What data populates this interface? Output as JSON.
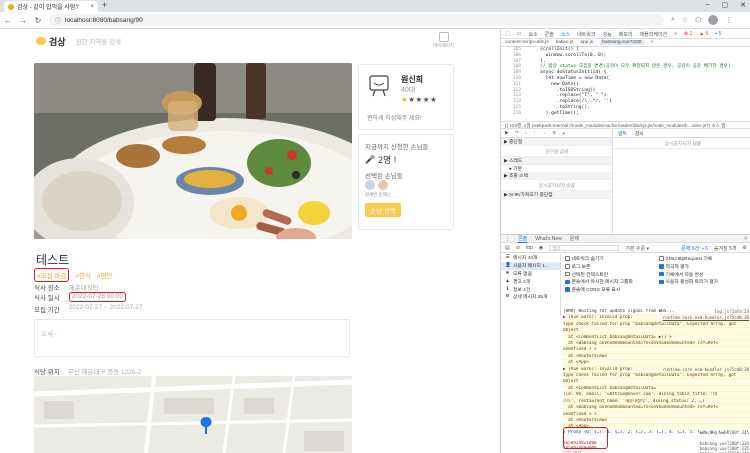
{
  "browser": {
    "tab_title": "검상 - 같이 밥먹을 사람?",
    "tab_close": "×",
    "new_tab": "+",
    "window_controls": [
      "–",
      "▢",
      "✕"
    ],
    "url": "localhost:8080/babsang/90",
    "profile_letter": ""
  },
  "site": {
    "logo_text": "검상",
    "search_placeholder": "원한 지역을 검색",
    "mypage_label": "마이페이지"
  },
  "host": {
    "name": "원신희",
    "age": "40대",
    "rating": 1,
    "stars": [
      "★",
      "★",
      "★",
      "★",
      "★"
    ],
    "message": "편하게 작성해주 세요!"
  },
  "applicants": {
    "label": "지금까지 신청한 손님들",
    "count_icon": "🎤",
    "count": "2명 !",
    "selected_label": "선택된 손님들",
    "selected_names": "원세빈 민재는",
    "select_button": "손님 선택"
  },
  "post": {
    "title": "테스트",
    "tags": [
      "#모집 마감",
      "#한식",
      "#편안"
    ],
    "info": [
      {
        "key": "식사 장소",
        "value": "해운대정탁"
      },
      {
        "key": "식사 일시",
        "value": "2022-07-28 00:00"
      },
      {
        "key": "모집 기간",
        "value": "2022-07-27 ~ 2022-07-27"
      }
    ],
    "content": "오세~",
    "location_key": "식당 위치",
    "location_value": "부산 해운대구 중동 1226-2"
  },
  "devtools": {
    "toolbar": [
      "요소",
      "콘솔",
      "소스",
      "네트워크",
      "성능",
      "메모리",
      "애플리케이션",
      "»"
    ],
    "toolbar_active": "소스",
    "badges": {
      "errors": "⊗ 1",
      "warnings": "▲ 6",
      "info": "▪ 5"
    },
    "file_tabs": [
      "content-script-utils.js",
      "kakao.js",
      "app.js",
      "babsang.vue?280f",
      "×"
    ],
    "active_file": "babsang.vue?280f",
    "code_lines": [
      {
        "n": "105",
        "t": "    scrollInit() {"
      },
      {
        "n": "106",
        "t": "      window.scrollTo(0, 0);"
      },
      {
        "n": "107",
        "t": "    },"
      },
      {
        "n": "108",
        "t": "    // 밥상 status 모집중 변경(공감이 모두 확정되지 않은 경우, 공감이 공감 배기한 경우)"
      },
      {
        "n": "109",
        "t": "    async doStatusInit(id) {"
      },
      {
        "n": "110",
        "t": "      let nowTime = new Date("
      },
      {
        "n": "111",
        "t": "        new Date()"
      },
      {
        "n": "112",
        "t": "          .toISOString()"
      },
      {
        "n": "113",
        "t": "          .replace(\"T\", \" \")"
      },
      {
        "n": "114",
        "t": "          .replace(/\\..*/, '')"
      },
      {
        "n": "115",
        "t": "          .toString(),"
      },
      {
        "n": "116",
        "t": "      ).getTime();"
      }
    ],
    "status_line": "{}   124행, 1열  (webpack-internal:///node_modules/cache-loader/dist/cjs.js!/node_modules/b...ndex.js?) 소스 맵",
    "debugger_controls": [
      "▶",
      "↷",
      "↓",
      "↑",
      "→",
      "⊘",
      "⏸"
    ],
    "watch_label": "▶ 중단점",
    "paused_text": "중단점 없음",
    "scope_label": "▶ 스레드",
    "thread_main": "● 기본",
    "callstack_label": "▶ 호출 스택",
    "not_paused": "일시중지되지 않음",
    "xhr_label": "▶ XHR/가져오기 중단점",
    "right_tabs": [
      "범위",
      "감시"
    ],
    "right_empty": "일시중지되지 않음",
    "drawer_tabs": [
      "콘솔",
      "What's New",
      "문제",
      "×"
    ],
    "console_context": "top",
    "filter_placeholder": "필터",
    "level": "기본 수준 ▾",
    "issues": "문제 6건: ▪ 6",
    "hidden": "숨겨짐 5개",
    "side": [
      {
        "icon": "☰",
        "label": "메시지 44개"
      },
      {
        "icon": "👤",
        "label": "사용자 메시지 1..."
      },
      {
        "icon": "⊗",
        "label": "오류 없음"
      },
      {
        "icon": "▲",
        "label": "경고 2개"
      },
      {
        "icon": "ℹ",
        "label": "정보 4건"
      },
      {
        "icon": "⚙",
        "label": "상세 메시지 35개"
      }
    ],
    "side_active": 1,
    "options": [
      {
        "label": "네트워크 숨기기",
        "on": false
      },
      {
        "label": "XMLHttpRequest 기록",
        "on": false
      },
      {
        "label": "로그 보존",
        "on": false
      },
      {
        "label": "적극적 평가",
        "on": true
      },
      {
        "label": "선택된 컨텍스트만",
        "on": false
      },
      {
        "label": "기록에서 자동 완성",
        "on": true
      },
      {
        "label": "콘솔에서 유사한 메시지 그룹화",
        "on": true
      },
      {
        "label": "사용자 활성화 트리거 평가",
        "on": true
      },
      {
        "label": "콘솔에 CORS 오류 표시",
        "on": true
      }
    ],
    "log": [
      {
        "cls": "hmr",
        "text": "[HMR] Waiting for update signal from WDS...",
        "src": "log.js?1afd:24"
      },
      {
        "cls": "warn",
        "text": "▶ [Vue warn]: Invalid prop:",
        "src": "runtime-core.esm-bundler.js?5c40:38"
      },
      {
        "cls": "warn",
        "text": "type check failed for prop \"babsangDetailData\". Expected Array, got",
        "src": ""
      },
      {
        "cls": "warn",
        "text": "Object",
        "src": ""
      },
      {
        "cls": "warn",
        "text": "  at <CommentList babsangDetailData= ▶{} >",
        "src": ""
      },
      {
        "cls": "warn",
        "text": "  at <Babsang onVnodeUnmounted=fn<onVnodeUnmounted> ref=Ref<",
        "src": ""
      },
      {
        "cls": "warn",
        "text": "undefined > >",
        "src": ""
      },
      {
        "cls": "warn",
        "text": "  at <RouterView>",
        "src": ""
      },
      {
        "cls": "warn",
        "text": "  at <App>",
        "src": ""
      },
      {
        "cls": "warn",
        "text": "▶ [Vue warn]: Invalid prop:",
        "src": "runtime-core.esm-bundler.js?5c40:38"
      },
      {
        "cls": "warn",
        "text": "type check failed for prop \"babsangDetailData\". Expected Array, got",
        "src": ""
      },
      {
        "cls": "warn",
        "text": "Object",
        "src": ""
      },
      {
        "cls": "warn",
        "text": "  at <CommentList babsangDetailData=",
        "src": ""
      },
      {
        "cls": "warn",
        "text": "{id: 90, email: 'u0ttrue@naver.com', dining_table_title: '테",
        "src": ""
      },
      {
        "cls": "warn",
        "text": "스트', restaurant_name: '해운대정탁', dining_status: 2, …}",
        "src": ""
      },
      {
        "cls": "warn",
        "text": "  at <Babsang onVnodeUnmounted=fn<onVnodeUnmounted> ref=Ref<",
        "src": ""
      },
      {
        "cls": "warn",
        "text": "undefined > >",
        "src": ""
      },
      {
        "cls": "warn",
        "text": "  at <RouterView>",
        "src": ""
      },
      {
        "cls": "warn",
        "text": "  at <App>",
        "src": ""
      },
      {
        "cls": "blue",
        "text": "▶ Proxy {0: {…}, 1: {…}, 2: {…}, 3: {…}, 4: {…}, 5: {…}, 6: {…}}",
        "src": "babsang.vue?280f:345"
      },
      {
        "cls": "blue",
        "text": "",
        "src": ""
      },
      {
        "cls": "red",
        "text": "1658934821000",
        "src": "babsang.vue?280f:334"
      },
      {
        "cls": "red",
        "text": "1658934000000",
        "src": "babsang.vue?280f:335"
      },
      {
        "cls": "g",
        "text": "모집 마감",
        "src": "babsang.vue?280f:344"
      }
    ]
  },
  "colors": {
    "accent": "#ffc94d",
    "tag": "#f5a623",
    "highlight": "#e01a1a",
    "devtools_blue": "#1a73e8"
  }
}
